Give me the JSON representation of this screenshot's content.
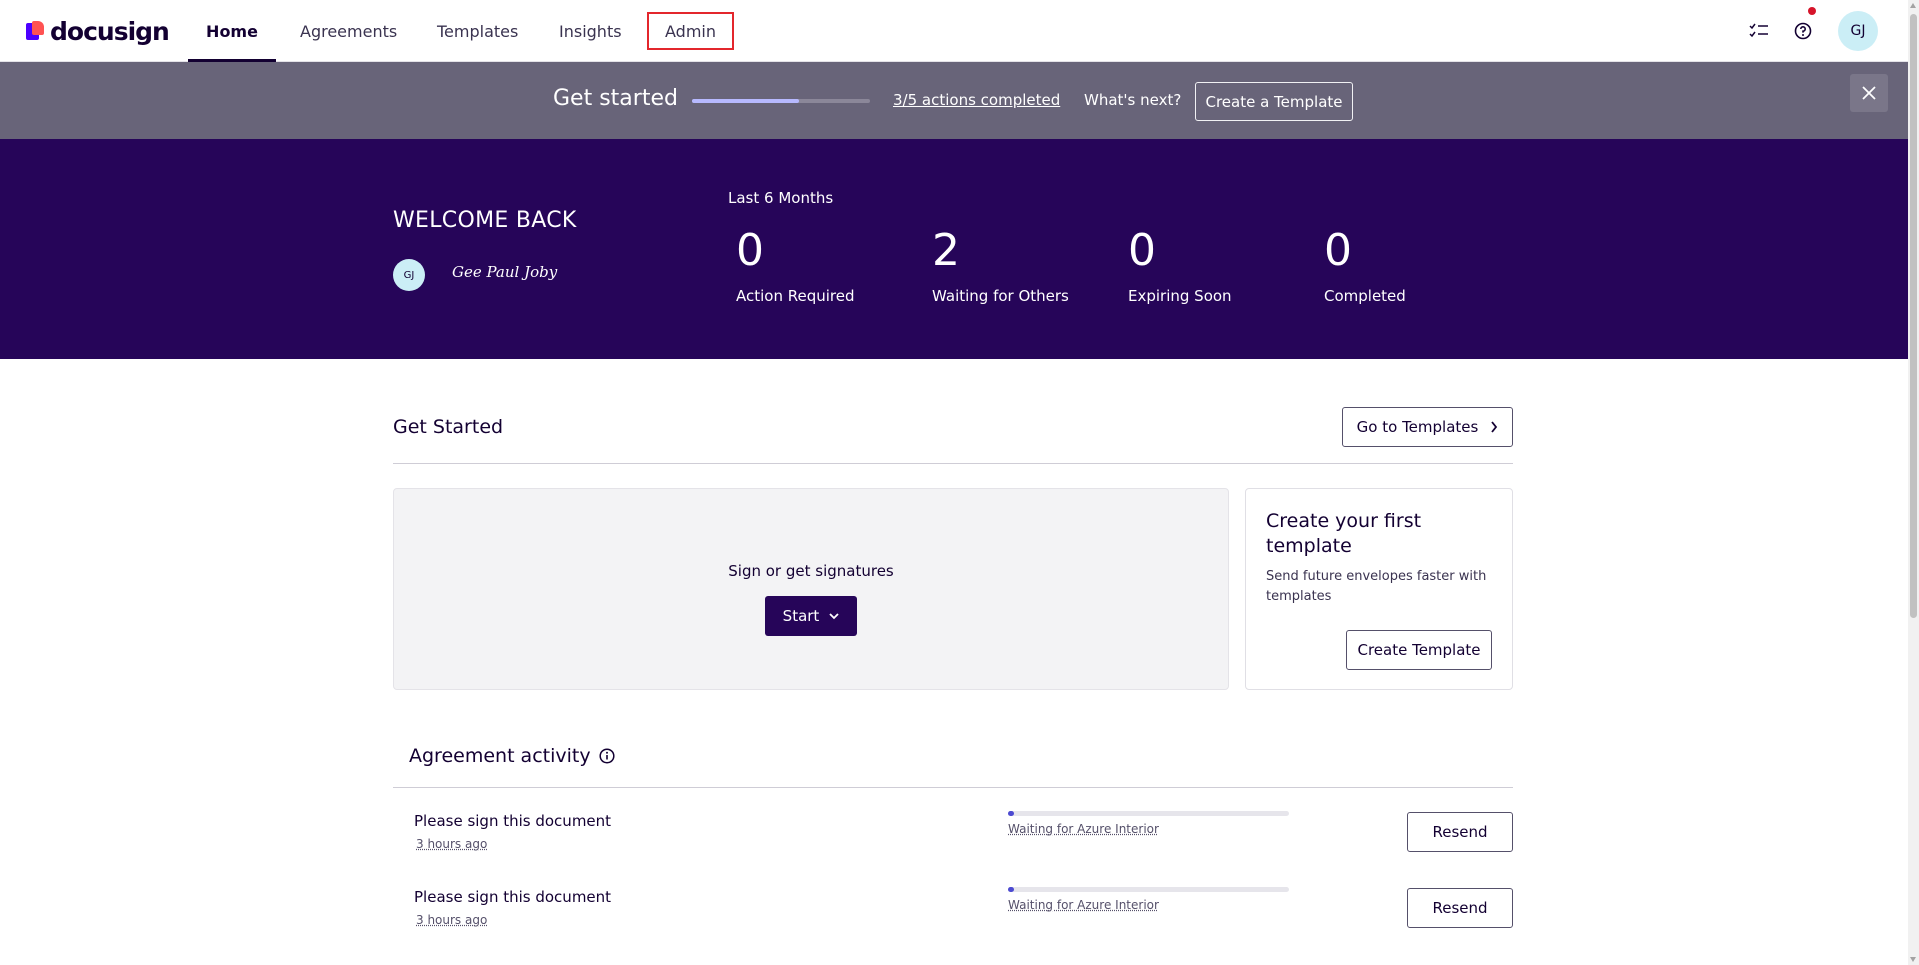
{
  "brand": {
    "name": "docusign"
  },
  "nav": {
    "tabs": [
      {
        "label": "Home",
        "active": true
      },
      {
        "label": "Agreements",
        "active": false
      },
      {
        "label": "Templates",
        "active": false
      },
      {
        "label": "Insights",
        "active": false
      },
      {
        "label": "Admin",
        "active": false
      }
    ],
    "icons": [
      "checklist-icon",
      "help-icon"
    ],
    "avatar_initials": "GJ"
  },
  "banner": {
    "title": "Get started",
    "progress_fraction": 0.6,
    "progress_text": "3/5 actions completed",
    "whats_next": "What's next?",
    "cta_label": "Create a Template"
  },
  "hero": {
    "welcome": "WELCOME BACK",
    "avatar_initials": "GJ",
    "signature": "Gee Paul Joby",
    "period": "Last 6 Months",
    "stats": [
      {
        "value": "0",
        "label": "Action Required"
      },
      {
        "value": "2",
        "label": "Waiting for Others"
      },
      {
        "value": "0",
        "label": "Expiring Soon"
      },
      {
        "value": "0",
        "label": "Completed"
      }
    ]
  },
  "get_started": {
    "title": "Get Started",
    "go_to_templates": "Go to Templates",
    "sign_label": "Sign or get signatures",
    "start_label": "Start",
    "template_card": {
      "title": "Create your first template",
      "description": "Send future envelopes faster with templates",
      "button": "Create Template"
    }
  },
  "activity": {
    "title": "Agreement activity",
    "rows": [
      {
        "title": "Please sign this document",
        "time": "3 hours ago",
        "status": "Waiting for Azure Interior",
        "progress_fraction": 0.02,
        "action": "Resend"
      },
      {
        "title": "Please sign this document",
        "time": "3 hours ago",
        "status": "Waiting for Azure Interior",
        "progress_fraction": 0.02,
        "action": "Resend"
      }
    ]
  },
  "colors": {
    "banner_bg": "#686479",
    "hero_bg": "#260559",
    "primary": "#260559",
    "highlight_box": "#e3262c"
  }
}
